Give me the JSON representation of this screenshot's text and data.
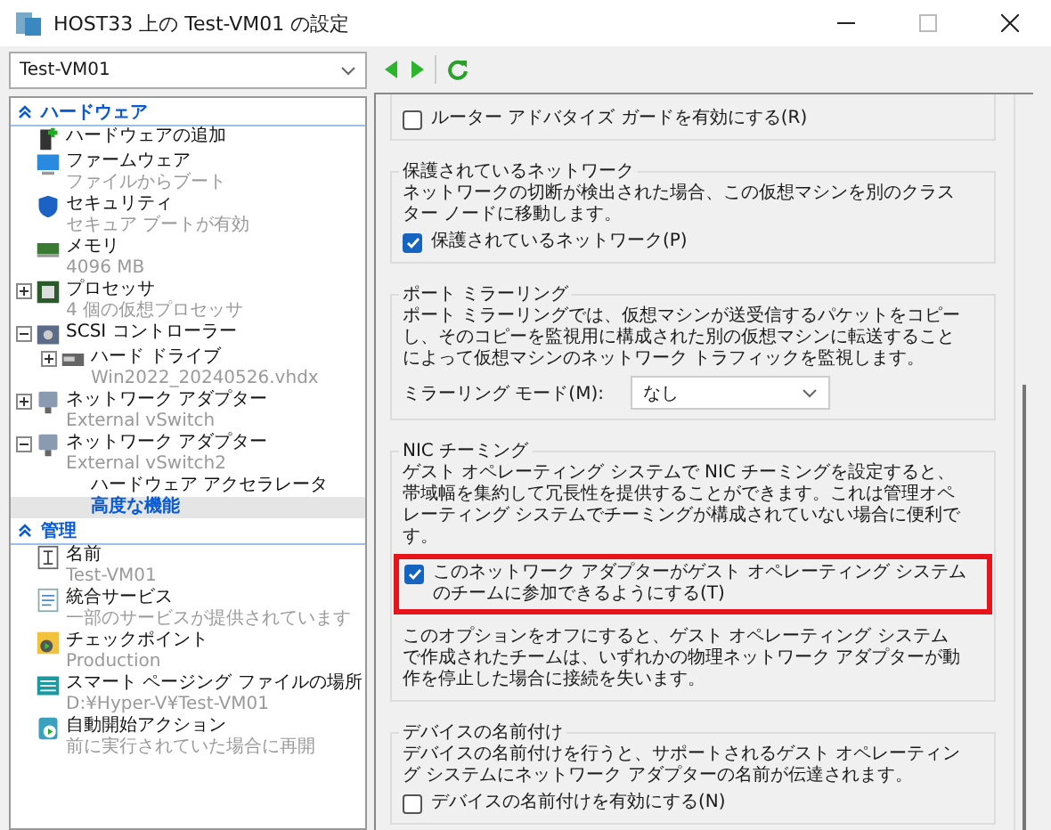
{
  "window": {
    "title": "HOST33 上の Test-VM01 の設定",
    "maximize_disabled": true
  },
  "vm_select": {
    "value": "Test-VM01"
  },
  "tree": [
    {
      "kind": "heading",
      "label": "ハードウェア",
      "expanded": true,
      "children": [
        {
          "kind": "item",
          "label": "ハードウェアの追加",
          "selected": false
        },
        {
          "kind": "item",
          "label": "ファームウェア",
          "sub": "ファイルからブート",
          "selected": false
        },
        {
          "kind": "item",
          "label": "セキュリティ",
          "sub": "セキュア ブートが有効",
          "selected": false
        },
        {
          "kind": "item",
          "label": "メモリ",
          "sub": "4096 MB",
          "selected": false
        },
        {
          "kind": "item",
          "label": "プロセッサ",
          "sub": "4 個の仮想プロセッサ",
          "expanded": false,
          "selected": false
        },
        {
          "kind": "item",
          "label": "SCSI コントローラー",
          "expanded": true,
          "selected": false,
          "children": [
            {
              "kind": "item",
              "label": "ハード ドライブ",
              "sub": "Win2022_20240526.vhdx",
              "expanded": false,
              "selected": false
            }
          ]
        },
        {
          "kind": "item",
          "label": "ネットワーク アダプター",
          "sub": "External vSwitch",
          "expanded": false,
          "selected": false
        },
        {
          "kind": "item",
          "label": "ネットワーク アダプター",
          "sub": "External vSwitch2",
          "expanded": true,
          "selected": false,
          "children": [
            {
              "kind": "plain",
              "label": "ハードウェア アクセラレータ",
              "selected": false
            },
            {
              "kind": "plain",
              "label": "高度な機能",
              "selected": true
            }
          ]
        }
      ]
    },
    {
      "kind": "heading",
      "label": "管理",
      "expanded": true,
      "children": [
        {
          "kind": "item",
          "label": "名前",
          "sub": "Test-VM01",
          "selected": false
        },
        {
          "kind": "item",
          "label": "統合サービス",
          "sub": "一部のサービスが提供されています",
          "selected": false
        },
        {
          "kind": "item",
          "label": "チェックポイント",
          "sub": "Production",
          "selected": false
        },
        {
          "kind": "item",
          "label": "スマート ページング ファイルの場所",
          "sub": "D:¥Hyper-V¥Test-VM01",
          "selected": false
        },
        {
          "kind": "item",
          "label": "自動開始アクション",
          "sub": "前に実行されていた場合に再開",
          "selected": false
        }
      ]
    }
  ],
  "groups": [
    {
      "checkbox": {
        "label": "ルーター アドバタイズ ガードを有効にする(R)",
        "checked": false,
        "highlighted": false
      }
    },
    {
      "title": "保護されているネットワーク",
      "description": "ネットワークの切断が検出された場合、この仮想マシンを別のクラスター ノードに移動します。",
      "checkbox": {
        "label": "保護されているネットワーク(P)",
        "checked": true,
        "highlighted": false
      }
    },
    {
      "title": "ポート ミラーリング",
      "description": "ポート ミラーリングでは、仮想マシンが送受信するパケットをコピーし、そのコピーを監視用に構成された別の仮想マシンに転送することによって仮想マシンのネットワーク トラフィックを監視します。",
      "select": {
        "label": "ミラーリング モード(M):",
        "value": "なし"
      }
    },
    {
      "title": "NIC チーミング",
      "description": "ゲスト オペレーティング システムで NIC チーミングを設定すると、帯域幅を集約して冗長性を提供することができます。これは管理オペレーティング システムでチーミングが構成されていない場合に便利です。",
      "checkbox": {
        "label": "このネットワーク アダプターがゲスト オペレーティング システムのチームに参加できるようにする(T)",
        "checked": true,
        "highlighted": true
      },
      "note": "このオプションをオフにすると、ゲスト オペレーティング システムで作成されたチームは、いずれかの物理ネットワーク アダプターが動作を停止した場合に接続を失います。"
    },
    {
      "title": "デバイスの名前付け",
      "description": "デバイスの名前付けを行うと、サポートされるゲスト オペレーティング システムにネットワーク アダプターの名前が伝達されます。",
      "checkbox": {
        "label": "デバイスの名前付けを有効にする(N)",
        "checked": false,
        "highlighted": false
      }
    }
  ]
}
